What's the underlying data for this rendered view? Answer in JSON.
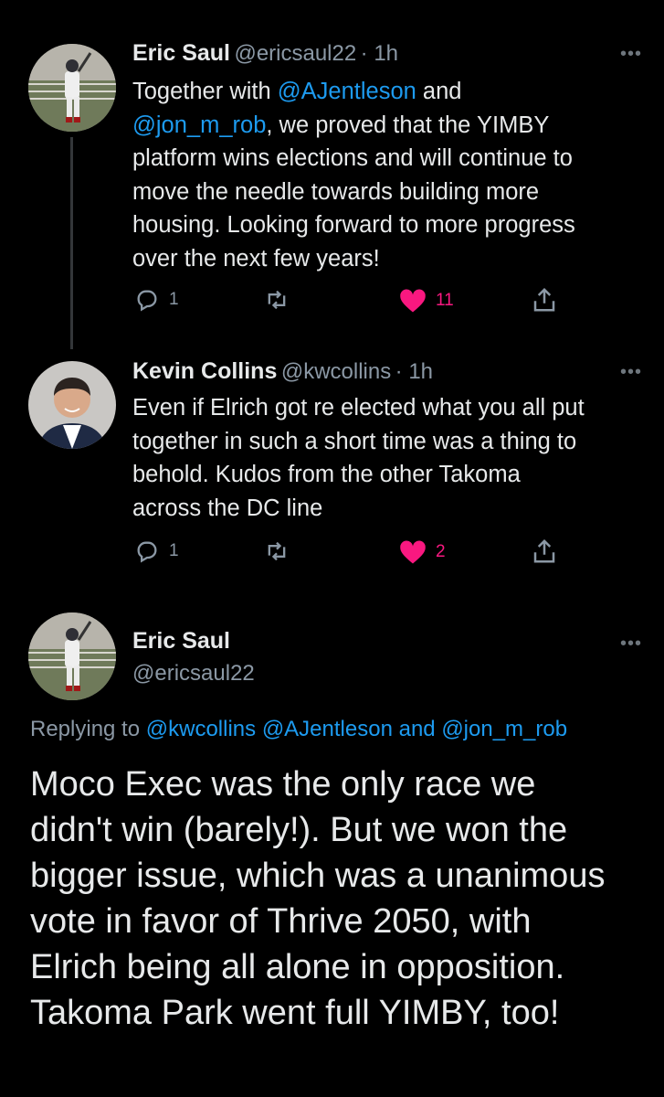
{
  "tweets": [
    {
      "name": "Eric Saul",
      "handle": "@ericsaul22",
      "time": "· 1h",
      "more": "•••",
      "lines": [
        {
          "pre": "Together with ",
          "link": "@AJentleson",
          "post": " and"
        },
        {
          "pre": "",
          "link": "@jon_m_rob",
          "post": ", we proved that the YIMBY"
        },
        {
          "pre": "platform wins elections and will continue to",
          "link": "",
          "post": ""
        },
        {
          "pre": "move the needle towards building more",
          "link": "",
          "post": ""
        },
        {
          "pre": "housing. Looking forward to more progress",
          "link": "",
          "post": ""
        },
        {
          "pre": "over the next few years!",
          "link": "",
          "post": ""
        }
      ],
      "replies": "1",
      "retweets": "",
      "likes": "11"
    },
    {
      "name": "Kevin Collins",
      "handle": "@kwcollins",
      "time": "· 1h",
      "more": "•••",
      "lines": [
        "Even if Elrich got re elected what you all put",
        "together in such a short time was a thing to",
        "behold. Kudos from the other Takoma",
        "across the DC line"
      ],
      "replies": "1",
      "retweets": "",
      "likes": "2"
    }
  ],
  "main_tweet": {
    "name": "Eric Saul",
    "handle": "@ericsaul22",
    "more": "•••",
    "replying_prefix": "Replying to ",
    "replying_users": [
      "@kwcollins",
      "@AJentleson"
    ],
    "replying_and": " and ",
    "replying_last": "@jon_m_rob",
    "lines": [
      "Moco Exec was the only race we",
      "didn't win (barely!). But we won the",
      "bigger issue, which was a unanimous",
      "vote in favor of Thrive 2050, with",
      "Elrich being all alone in opposition.",
      "Takoma Park went full YIMBY, too!"
    ]
  },
  "colors": {
    "background": "#000000",
    "text": "#e7e9ea",
    "secondary": "#8b98a5",
    "link": "#1d9bf0",
    "like": "#f91880"
  }
}
